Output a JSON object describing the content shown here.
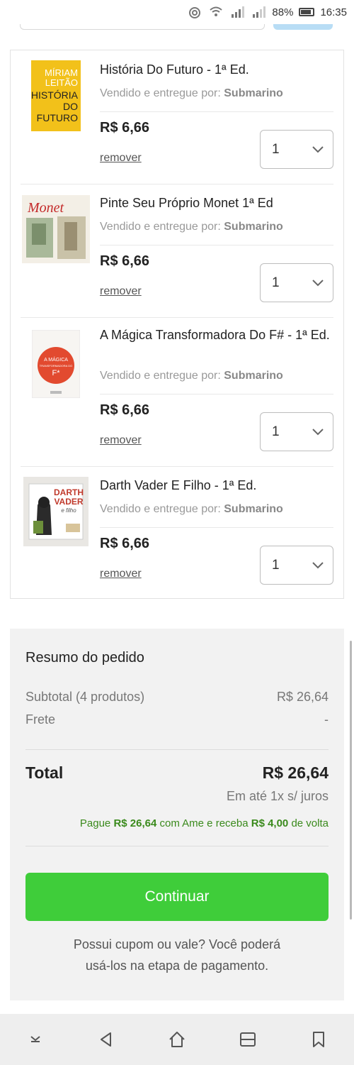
{
  "status_bar": {
    "battery": "88%",
    "time": "16:35",
    "icons": [
      "sync-icon",
      "wifi-icon",
      "signal-1-icon",
      "signal-2-icon",
      "battery-icon"
    ]
  },
  "cart": {
    "seller_prefix": "Vendido e entregue por: ",
    "items": [
      {
        "title": "História Do Futuro - 1ª Ed.",
        "seller": "Submarino",
        "price": "R$ 6,66",
        "remove": "remover",
        "qty": "1",
        "thumb": "book-historia-do-futuro"
      },
      {
        "title": "Pinte Seu Próprio Monet 1ª Ed",
        "seller": "Submarino",
        "price": "R$ 6,66",
        "remove": "remover",
        "qty": "1",
        "thumb": "book-monet"
      },
      {
        "title": "A Mágica Transformadora Do F# - 1ª Ed.",
        "seller": "Submarino",
        "price": "R$ 6,66",
        "remove": "remover",
        "qty": "1",
        "thumb": "book-a-magica"
      },
      {
        "title": "Darth Vader E Filho - 1ª Ed.",
        "seller": "Submarino",
        "price": "R$ 6,66",
        "remove": "remover",
        "qty": "1",
        "thumb": "book-darth-vader"
      }
    ]
  },
  "summary": {
    "title": "Resumo do pedido",
    "subtotal_label": "Subtotal (4 produtos)",
    "subtotal_value": "R$ 26,64",
    "frete_label": "Frete",
    "frete_value": "-",
    "total_label": "Total",
    "total_value": "R$ 26,64",
    "installment": "Em até 1x s/ juros",
    "ame_1": "Pague ",
    "ame_amount": "R$ 26,64",
    "ame_2": " com Ame e receba ",
    "ame_cashback": "R$ 4,00",
    "ame_3": " de volta",
    "continue_label": "Continuar",
    "coupon_line1": "Possui cupom ou vale? Você poderá",
    "coupon_line2": "usá-los na etapa de pagamento."
  },
  "book_covers": {
    "historia": [
      "MÍRIAM",
      "LEITÃO",
      "HISTÓRIA",
      "DO",
      "FUTURO"
    ],
    "monet": "Monet",
    "magica": [
      "A MÁGICA",
      "TRANSFORMADORA DO",
      "F*"
    ],
    "vader": [
      "DARTH",
      "VADER",
      "e filho"
    ]
  },
  "colors": {
    "accent_green": "#3fcd3a",
    "ame_green": "#3a8a1c",
    "summary_bg": "#f2f2f2"
  },
  "nav": [
    "down-chevron-icon",
    "back-icon",
    "home-icon",
    "recents-icon",
    "bookmark-icon"
  ]
}
